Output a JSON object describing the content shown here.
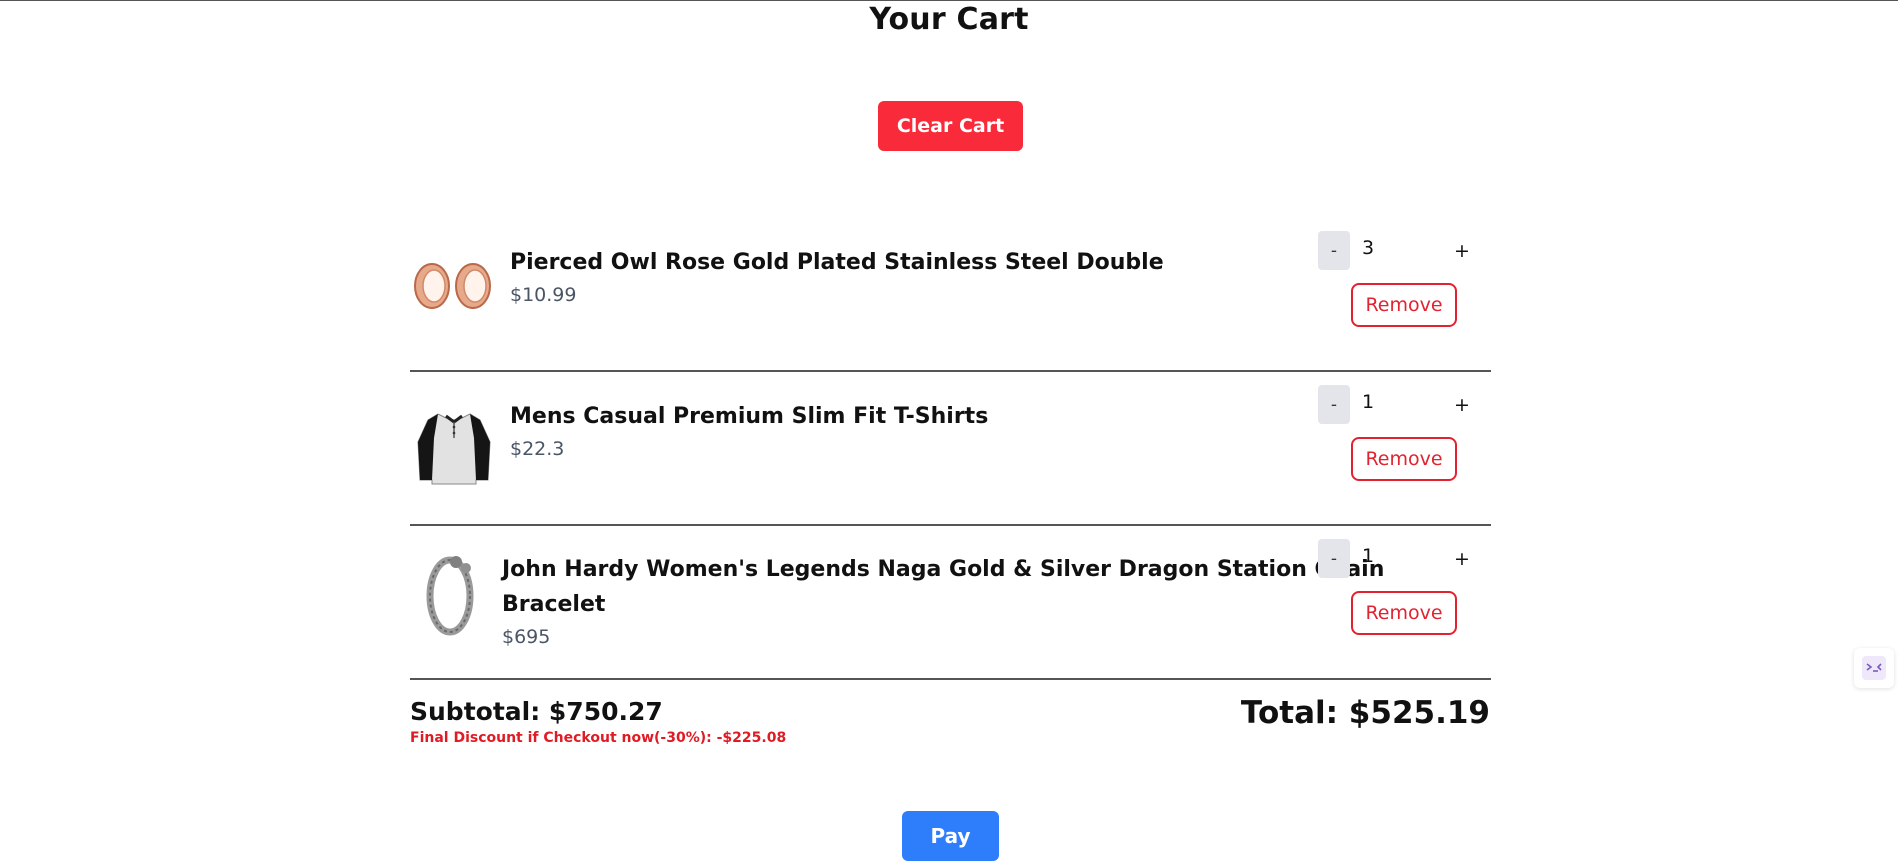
{
  "page": {
    "title": "Your Cart",
    "clear_label": "Clear Cart",
    "pay_label": "Pay"
  },
  "cart": {
    "items": [
      {
        "name": "Pierced Owl Rose Gold Plated Stainless Steel Double",
        "price": "$10.99",
        "quantity": "3",
        "remove_label": "Remove",
        "minus_label": "-",
        "plus_label": "+",
        "image": "rose-gold-plugs-image"
      },
      {
        "name": "Mens Casual Premium Slim Fit T-Shirts",
        "price": "$22.3",
        "quantity": "1",
        "remove_label": "Remove",
        "minus_label": "-",
        "plus_label": "+",
        "image": "raglan-tshirt-image"
      },
      {
        "name_line1": "John Hardy Women's Legends Naga Gold & Silver Dragon Station Chain",
        "name_line2": "Bracelet",
        "price": "$695",
        "quantity": "1",
        "remove_label": "Remove",
        "minus_label": "-",
        "plus_label": "+",
        "image": "dragon-bracelet-image"
      }
    ]
  },
  "summary": {
    "subtotal": "Subtotal: $750.27",
    "discount": "Final Discount if Checkout now(-30%): -$225.08",
    "total": "Total: $525.19"
  },
  "colors": {
    "clear_button": "#f92b3a",
    "pay_button": "#2e7dfb",
    "remove_border": "#e32230",
    "discount_text": "#e01b24",
    "price_text": "#4a5565"
  }
}
